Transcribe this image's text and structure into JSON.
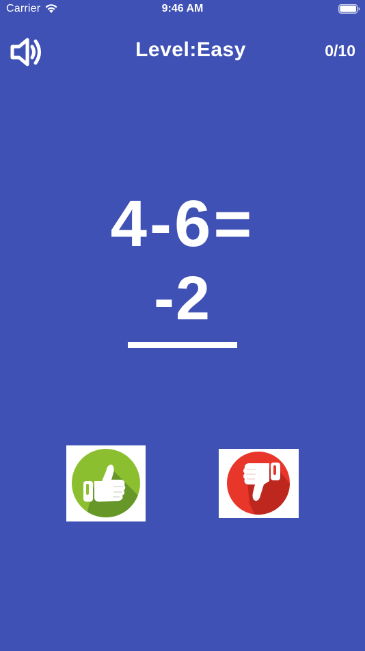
{
  "status_bar": {
    "carrier": "Carrier",
    "time": "9:46 AM",
    "icons": [
      "wifi-icon",
      "battery-icon"
    ]
  },
  "header": {
    "sound_icon": "speaker-volume-icon",
    "title": "Level:Easy",
    "score": "0/10"
  },
  "question": {
    "equation": "4-6=",
    "answer": "-2"
  },
  "buttons": {
    "correct_icon": "thumbs-up-icon",
    "wrong_icon": "thumbs-down-icon"
  },
  "colors": {
    "background": "#3f51b5",
    "correct": "#8bbf2f",
    "wrong": "#e8362b",
    "text": "#ffffff"
  }
}
